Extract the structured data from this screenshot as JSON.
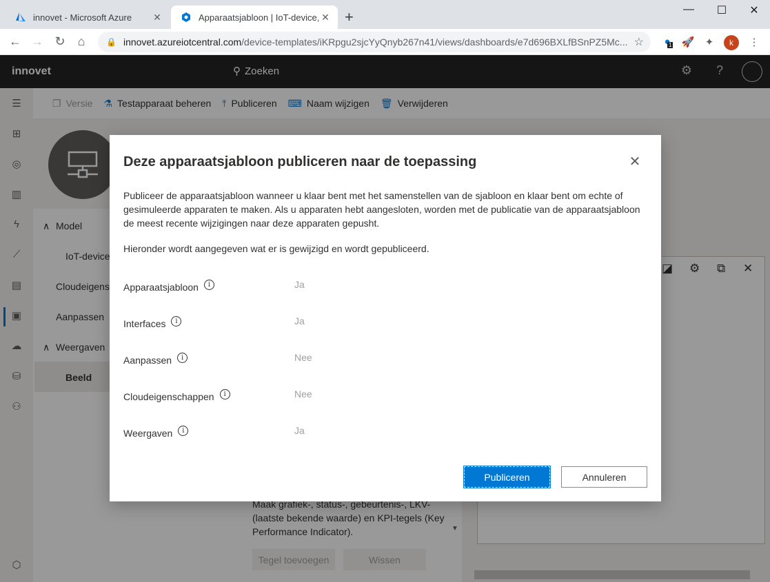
{
  "browser": {
    "tabs": [
      {
        "title": "innovet - Microsoft Azure"
      },
      {
        "title": "Apparaatsjabloon | IoT-device, in"
      }
    ],
    "new_tab": "+",
    "address": {
      "host": "innovet.azureiotcentral.com",
      "path": "/device-templates/iKRpgu2sjcYyQnyb267n41/views/dashboards/e7d696BXLfBSnPZ5Mc..."
    },
    "profile_initial": "k",
    "ext_badge": "1"
  },
  "app": {
    "name": "innovet",
    "search_label": "Zoeken"
  },
  "commands": {
    "version": "Versie",
    "manage_test_device": "Testapparaat beheren",
    "publish": "Publiceren",
    "rename": "Naam wijzigen",
    "delete": "Verwijderen"
  },
  "nav": {
    "model": "Model",
    "iot_device": "IoT-device",
    "cloud_props": "Cloudeigensc",
    "customize": "Aanpassen",
    "views": "Weergaven",
    "view_item": "Beeld"
  },
  "panel": {
    "description": "Maak grafiek-, status-, gebeurtenis-, LKV-(laatste bekende waarde) en KPI-tegels (Key Performance Indicator).",
    "add_tile": "Tegel toevoegen",
    "clear": "Wissen"
  },
  "dialog": {
    "title": "Deze apparaatsjabloon publiceren naar de toepassing",
    "description": "Publiceer de apparaatsjabloon wanneer u klaar bent met het samenstellen van de sjabloon en klaar bent om echte of gesimuleerde apparaten te maken. Als u apparaten hebt aangesloten, worden met de publicatie van de apparaatsjabloon de meest recente wijzigingen naar deze apparaten gepusht.",
    "subtitle": "Hieronder wordt aangegeven wat er is gewijzigd en wordt gepubliceerd.",
    "rows": [
      {
        "label": "Apparaatsjabloon",
        "value": "Ja"
      },
      {
        "label": "Interfaces",
        "value": "Ja"
      },
      {
        "label": "Aanpassen",
        "value": "Nee"
      },
      {
        "label": "Cloudeigenschappen",
        "value": "Nee"
      },
      {
        "label": "Weergaven",
        "value": "Ja"
      }
    ],
    "primary_button": "Publiceren",
    "secondary_button": "Annuleren"
  },
  "colors": {
    "accent": "#0078d4",
    "header_bg": "#252423",
    "avatar": "#c5441c"
  }
}
